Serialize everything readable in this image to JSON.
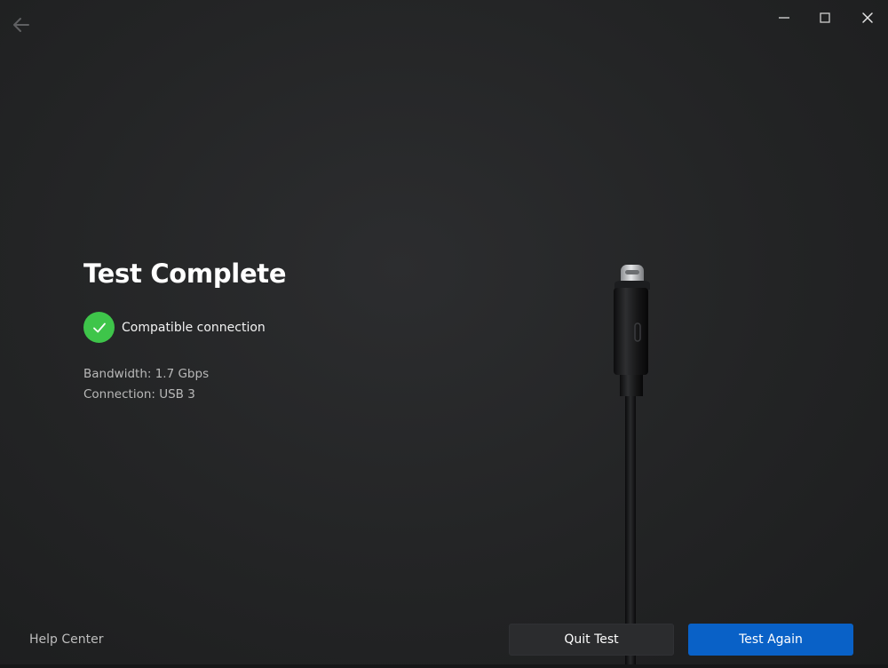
{
  "window": {
    "controls": {
      "back_icon": "arrow-left-icon",
      "minimize_icon": "minimize-icon",
      "maximize_icon": "maximize-icon",
      "close_icon": "close-icon"
    }
  },
  "main": {
    "title": "Test Complete",
    "status": {
      "icon": "checkmark-icon",
      "text": "Compatible connection",
      "color": "#3ec54a"
    },
    "bandwidth": "Bandwidth: 1.7 Gbps",
    "connection": "Connection: USB 3"
  },
  "illustration": {
    "name": "usb-c-cable"
  },
  "footer": {
    "help_label": "Help Center",
    "quit_label": "Quit Test",
    "again_label": "Test Again",
    "accent_color": "#0961c7"
  }
}
